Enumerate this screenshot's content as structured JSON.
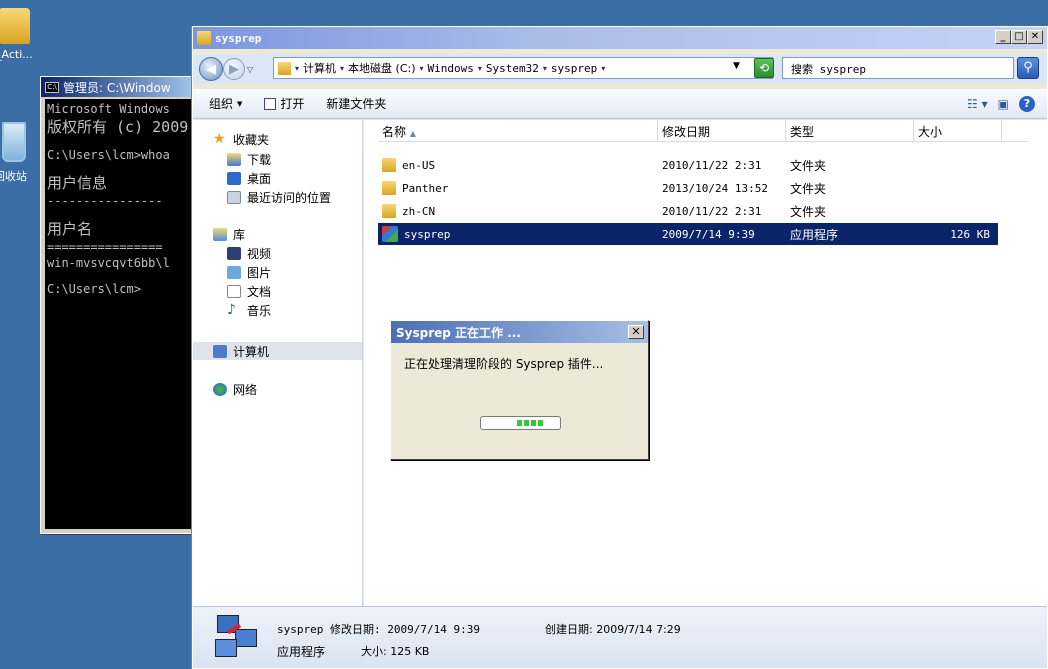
{
  "desktop": {
    "folder_label": "_Acti...",
    "recycle_label": "回收站"
  },
  "cmd": {
    "title": "管理员: C:\\Window",
    "lines": [
      "Microsoft Windows",
      "版权所有 (c) 2009",
      "",
      "C:\\Users\\lcm>whoa",
      "",
      "用户信息",
      "----------------",
      "",
      "用户名",
      "================",
      "win-mvsvcqvt6bb\\l",
      "",
      "C:\\Users\\lcm>"
    ]
  },
  "explorer": {
    "title": "sysprep",
    "address": {
      "crumbs": [
        "计算机",
        "本地磁盘 (C:)",
        "Windows",
        "System32",
        "sysprep"
      ]
    },
    "search_placeholder": "搜索 sysprep",
    "toolbar": {
      "organize": "组织",
      "open": "打开",
      "new_folder": "新建文件夹"
    },
    "nav": {
      "favorites": "收藏夹",
      "downloads": "下载",
      "desktop": "桌面",
      "recent": "最近访问的位置",
      "libraries": "库",
      "videos": "视频",
      "pictures": "图片",
      "documents": "文档",
      "music": "音乐",
      "computer": "计算机",
      "network": "网络"
    },
    "columns": {
      "name": "名称",
      "modified": "修改日期",
      "type": "类型",
      "size": "大小"
    },
    "files": [
      {
        "name": "en-US",
        "modified": "2010/11/22 2:31",
        "type": "文件夹",
        "size": ""
      },
      {
        "name": "Panther",
        "modified": "2013/10/24 13:52",
        "type": "文件夹",
        "size": ""
      },
      {
        "name": "zh-CN",
        "modified": "2010/11/22 2:31",
        "type": "文件夹",
        "size": ""
      },
      {
        "name": "sysprep",
        "modified": "2009/7/14 9:39",
        "type": "应用程序",
        "size": "126 KB"
      }
    ],
    "details": {
      "name_line": "sysprep  修改日期: 2009/7/14 9:39",
      "type": "应用程序",
      "size_line": "大小: 125 KB",
      "created_line": "创建日期: 2009/7/14 7:29"
    }
  },
  "dialog": {
    "title": "Sysprep 正在工作 ...",
    "message": "正在处理清理阶段的 Sysprep 插件...",
    "progress": 0.35
  }
}
